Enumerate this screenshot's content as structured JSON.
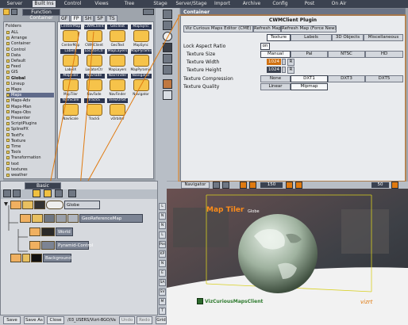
{
  "menu": [
    "Server",
    "Built Ins",
    "Control",
    "Views",
    "Tree",
    "Stage",
    "Server/Stage",
    "Import",
    "Archive",
    "Config",
    "Post",
    "On Air"
  ],
  "menu_active": "Built Ins",
  "left_panel": {
    "tab_function_container": "Function Container",
    "plugin_tabs": [
      "GF",
      "FP",
      "SH",
      "SP",
      "TS"
    ],
    "folders_header": "Folders",
    "folders": [
      "ALL",
      "Arrange",
      "Container",
      "Control",
      "Data",
      "Default",
      "Feed",
      "GIS",
      "Global",
      "Lineup",
      "Maps",
      "Maps",
      "Maps-Adv",
      "Maps-Man",
      "Maps-Obs",
      "Presenter",
      "ScriptPlugins",
      "SplinePX",
      "TextFx",
      "Texture",
      "Time",
      "Tools",
      "Transformation",
      "text",
      "textures",
      "weather"
    ],
    "selected_folder": "Maps",
    "plugins": [
      {
        "title": "CenterMap",
        "label": "CenterMap"
      },
      {
        "title": "CWMClient",
        "label": "CWMClient"
      },
      {
        "title": "GeoText",
        "label": "GeoText"
      },
      {
        "title": "MapSync",
        "label": "MapSync"
      },
      {
        "title": "LabelX",
        "label": "LabelX"
      },
      {
        "title": "LocatorCtr",
        "label": "LocatorCtr"
      },
      {
        "title": "MapLayers",
        "label": "MapLayers"
      },
      {
        "title": "MapPyramid",
        "label": "MapPyramid"
      },
      {
        "title": "MapTiler",
        "label": "MapTiler"
      },
      {
        "title": "NavFade",
        "label": "NavFade"
      },
      {
        "title": "NavFinder",
        "label": "NavFinder"
      },
      {
        "title": "Navigator",
        "label": "Navigator"
      },
      {
        "title": "NavScale",
        "label": "NavScale"
      },
      {
        "title": "TrackS",
        "label": "TrackS"
      },
      {
        "title": "ViewOrbit",
        "label": "vOrbiter"
      }
    ]
  },
  "container": {
    "header": "Container",
    "plugin_title": "CWMClient Plugin",
    "buttons": [
      "Viz Curious Maps Editor (CME)",
      "Refresh Map",
      "Refresh Map (Force New)"
    ],
    "tabs": [
      "Texture",
      "Labels",
      "3D Objects",
      "Miscellaneous"
    ],
    "lock_aspect_ratio_label": "Lock Aspect Ratio",
    "lock_aspect_ratio_value": "on",
    "texture_size_label": "Texture Size",
    "texture_size_options": [
      "Manual",
      "Pal",
      "NTSC",
      "HD"
    ],
    "texture_width_label": "Texture Width",
    "texture_width_value": "1024",
    "texture_height_label": "Texture Height",
    "texture_height_value": "1024",
    "texture_compression_label": "Texture Compression",
    "texture_compression_options": [
      "None",
      "DXT1",
      "DXT3",
      "DXT5"
    ],
    "texture_quality_label": "Texture Quality",
    "texture_quality_options": [
      "Linear",
      "Mipmap"
    ],
    "reset_label": "R"
  },
  "scene_tree": {
    "tab": "Basic",
    "nodes": [
      "Globe",
      "GeoReferenceMap",
      "World",
      "Pyramid-Control",
      "Background"
    ]
  },
  "bottom_bar": {
    "save": "Save",
    "save_as": "Save As",
    "close": "Close",
    "path": "/03_USERS/Vizrt-BGO/Va",
    "undo": "Undo",
    "redo": "Redo",
    "grid": "Grid"
  },
  "render_view": {
    "navigator_label": "Navigator",
    "zoom_value": "150",
    "fov_value": "50",
    "overlay_title": "Map Tiler",
    "overlay_subtitle": "Globe",
    "footer_logo_text": "VizCuriousMapsClient",
    "brand": "vizrt",
    "side_labels": [
      "L",
      "N",
      "N",
      "L",
      "Pos",
      "KP",
      "N",
      "E",
      "SA",
      "SV",
      "M",
      "T"
    ]
  },
  "colors": {
    "menubar": "#3b4250",
    "panel_bg": "#e9ebee",
    "accent_orange": "#e07a10",
    "plugin_icon": "#f6c34a"
  }
}
